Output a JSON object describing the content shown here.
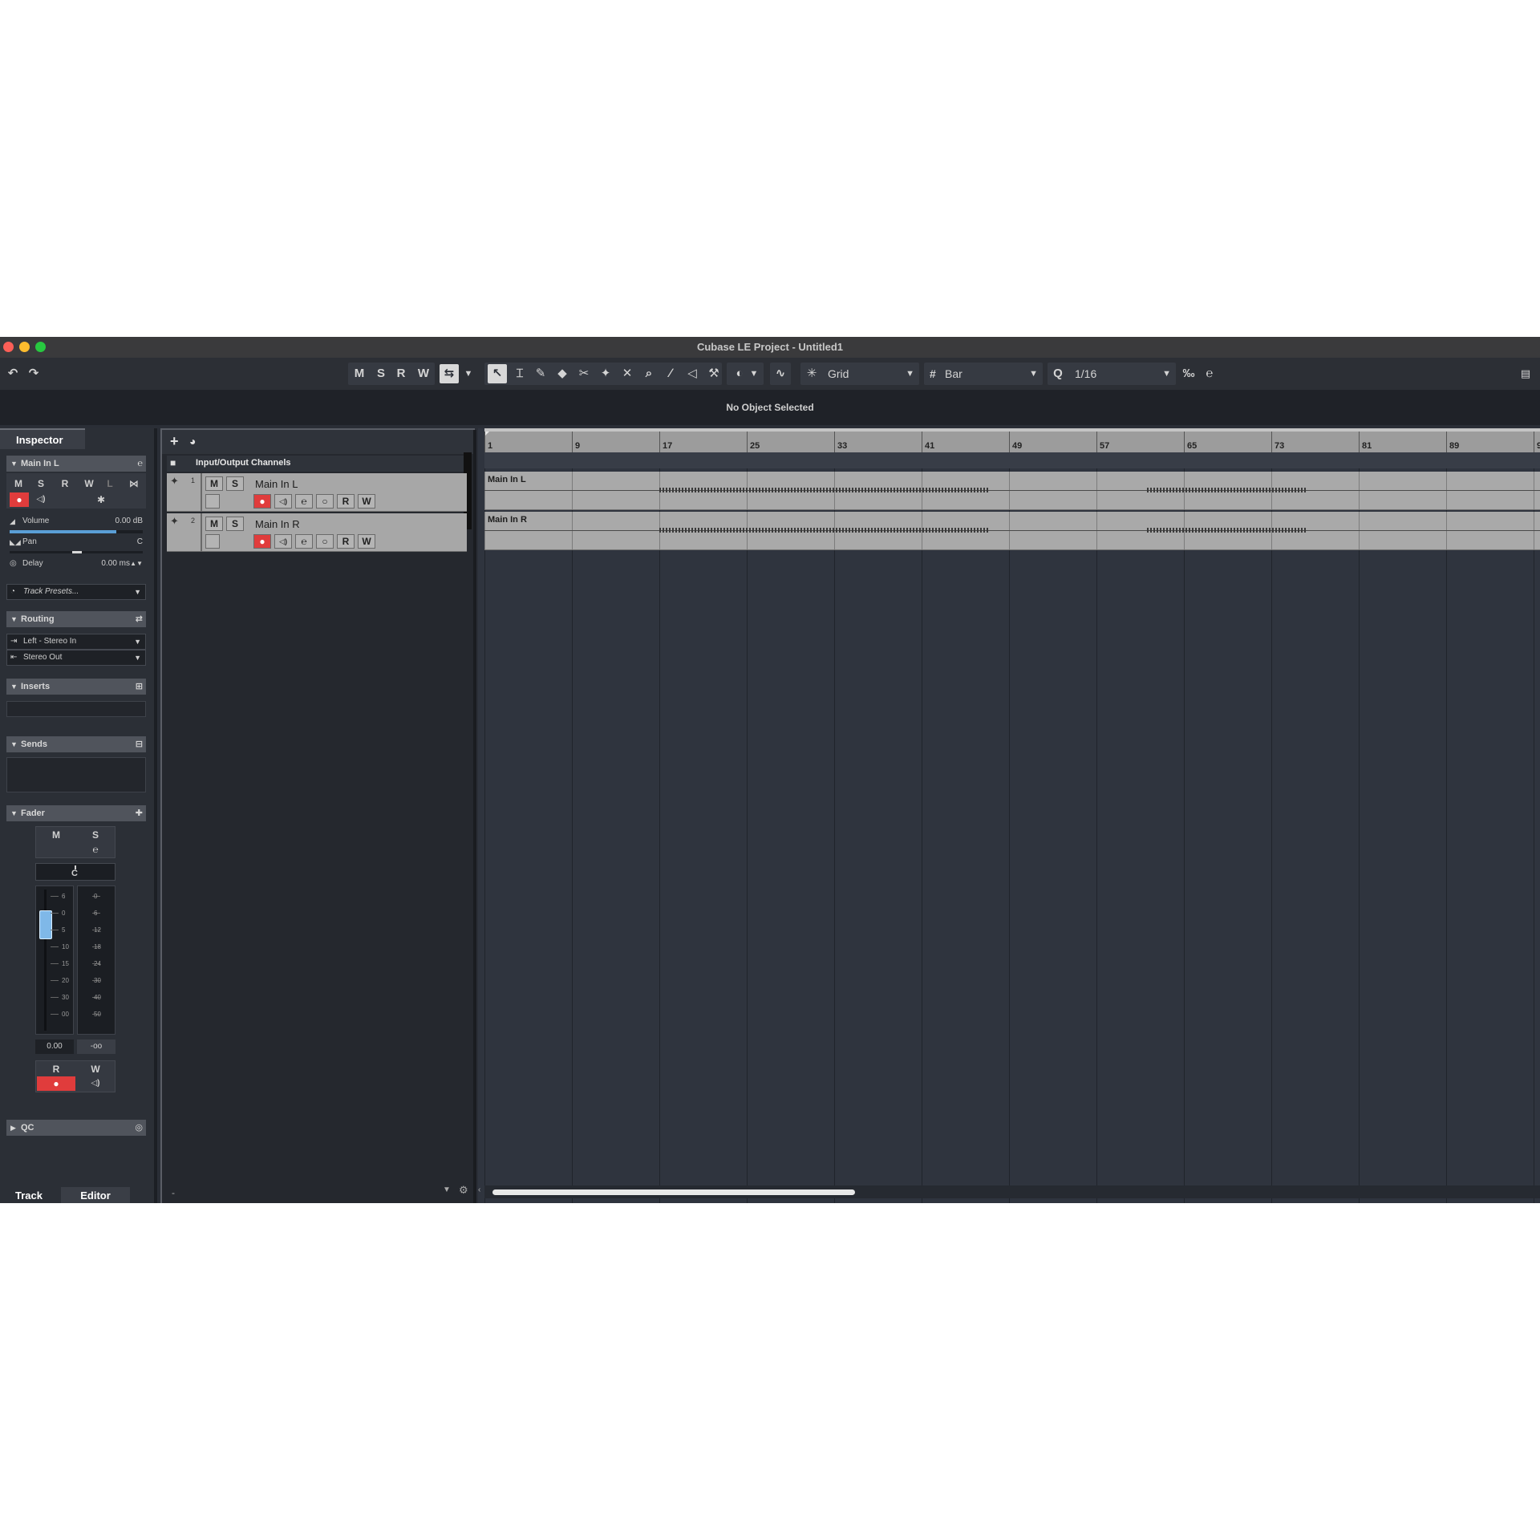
{
  "window": {
    "title": "Cubase LE Project - Untitled1",
    "traffic_colors": [
      "#fd5f57",
      "#febc2e",
      "#28c840"
    ]
  },
  "toolbar": {
    "undo_icon": "undo-icon",
    "redo_icon": "redo-icon",
    "m_label": "M",
    "s_label": "S",
    "r_label": "R",
    "w_label": "W",
    "snap_label": "Grid",
    "grid_label": "Bar",
    "quantize_label": "1/16"
  },
  "info_line": {
    "text": "No Object Selected"
  },
  "inspector": {
    "tab": "Inspector",
    "track_name": "Main In L",
    "m": "M",
    "s": "S",
    "r": "R",
    "w": "W",
    "l": "L",
    "volume_label": "Volume",
    "volume_value": "0.00 dB",
    "volume_fraction": 0.8,
    "pan_label": "Pan",
    "pan_value": "C",
    "delay_label": "Delay",
    "delay_value": "0.00 ms",
    "track_presets": "Track Presets...",
    "routing": "Routing",
    "input_routing": "Left - Stereo In",
    "output_routing": "Stereo Out",
    "inserts": "Inserts",
    "sends": "Sends",
    "fader": "Fader",
    "fader_m": "M",
    "fader_s": "S",
    "fader_pan": "C",
    "fader_scale_left": [
      "6",
      "0",
      "5",
      "10",
      "15",
      "20",
      "30",
      "00"
    ],
    "fader_scale_right": [
      "0",
      "6",
      "12",
      "18",
      "24",
      "30",
      "40",
      "50"
    ],
    "fader_value": "0.00",
    "meter_value": "-oo",
    "fader_r": "R",
    "fader_w": "W",
    "qc": "QC",
    "bottom_tab_track": "Track",
    "bottom_tab_editor": "Editor"
  },
  "tracklist": {
    "folder_name": "Input/Output Channels",
    "tracks": [
      {
        "number": "1",
        "name": "Main In L",
        "m": "M",
        "s": "S",
        "r": "R",
        "w": "W"
      },
      {
        "number": "2",
        "name": "Main In R",
        "m": "M",
        "s": "S",
        "r": "R",
        "w": "W"
      }
    ],
    "bottom_left": "-"
  },
  "project": {
    "bars": [
      "1",
      "9",
      "17",
      "25",
      "33",
      "41",
      "49",
      "57",
      "65",
      "73",
      "81",
      "89",
      "9"
    ],
    "events": [
      "Main In L",
      "Main In R"
    ]
  },
  "colors": {
    "record": "#e03c3c",
    "fader_cap": "#7fb8e8",
    "volume_bar": "#5a9fd6"
  }
}
